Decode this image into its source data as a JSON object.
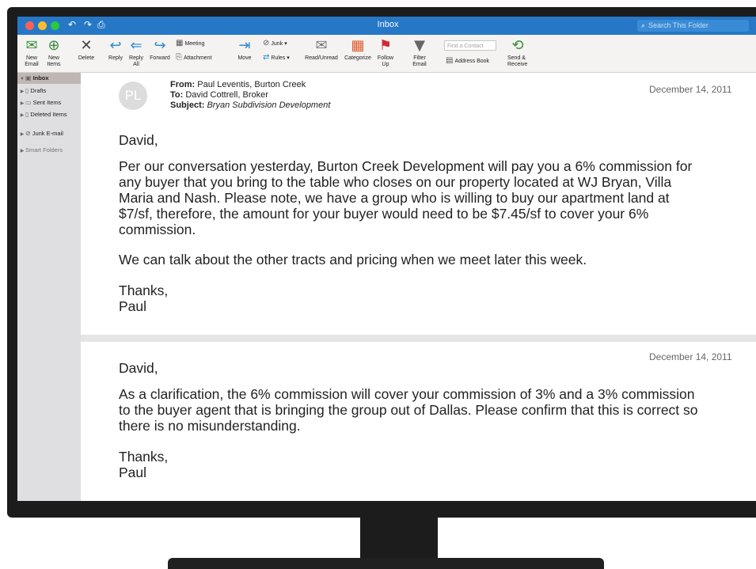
{
  "window": {
    "title": "Inbox"
  },
  "search": {
    "placeholder": "Search This Folder",
    "icon": "magnifier-icon"
  },
  "ribbon": {
    "new_email": "New Email",
    "new_items": "New Items",
    "delete": "Delete",
    "reply": "Reply",
    "reply_all": "Reply All",
    "forward": "Forward",
    "meeting": "Meeting",
    "attachment": "Attachment",
    "move": "Move",
    "junk": "Junk",
    "rules": "Rules",
    "read_unread": "Read/Unread",
    "categorize": "Categorize",
    "follow_up": "Follow Up",
    "filter_email": "Filter Email",
    "find_contact_placeholder": "Find a Contact",
    "address_book": "Address Book",
    "send_receive": "Send & Receive"
  },
  "sidebar": {
    "items": [
      {
        "label": "Inbox",
        "selected": true
      },
      {
        "label": "Drafts"
      },
      {
        "label": "Sent Items"
      },
      {
        "label": "Deleted Items"
      },
      {
        "label": "Junk E-mail"
      },
      {
        "label": "Smart Folders"
      }
    ]
  },
  "message1": {
    "avatar": "PL",
    "from_label": "From:",
    "from": "Paul Leventis, Burton Creek",
    "to_label": "To:",
    "to": "David Cottrell, Broker",
    "subject_label": "Subject:",
    "subject": "Bryan Subdivision Development",
    "date": "December 14, 2011",
    "greeting": "David,",
    "p1": "Per our conversation yesterday, Burton Creek Development will pay you a 6% commission for any buyer that you bring to the table who closes on our property located at WJ Bryan, Villa Maria and Nash. Please note, we have a group who is willing to buy our apartment land at $7/sf, therefore, the amount for your buyer would need to be $7.45/sf to cover your 6% commission.",
    "p2": "We can talk about the other tracts and pricing when we meet later this week.",
    "sign1": "Thanks,",
    "sign2": "Paul"
  },
  "message2": {
    "date": "December 14, 2011",
    "greeting": "David,",
    "p1": "As a clarification, the 6% commission will cover your commission of 3% and a 3% commission to the buyer agent that is bringing the group out of Dallas. Please confirm that this is correct so there is no misunderstanding.",
    "sign1": "Thanks,",
    "sign2": "Paul"
  },
  "colors": {
    "titlebar": "#2678c7",
    "sidebar": "#dfdfe2",
    "selected": "#c0b7b2",
    "bezel": "#1c1c1d"
  }
}
